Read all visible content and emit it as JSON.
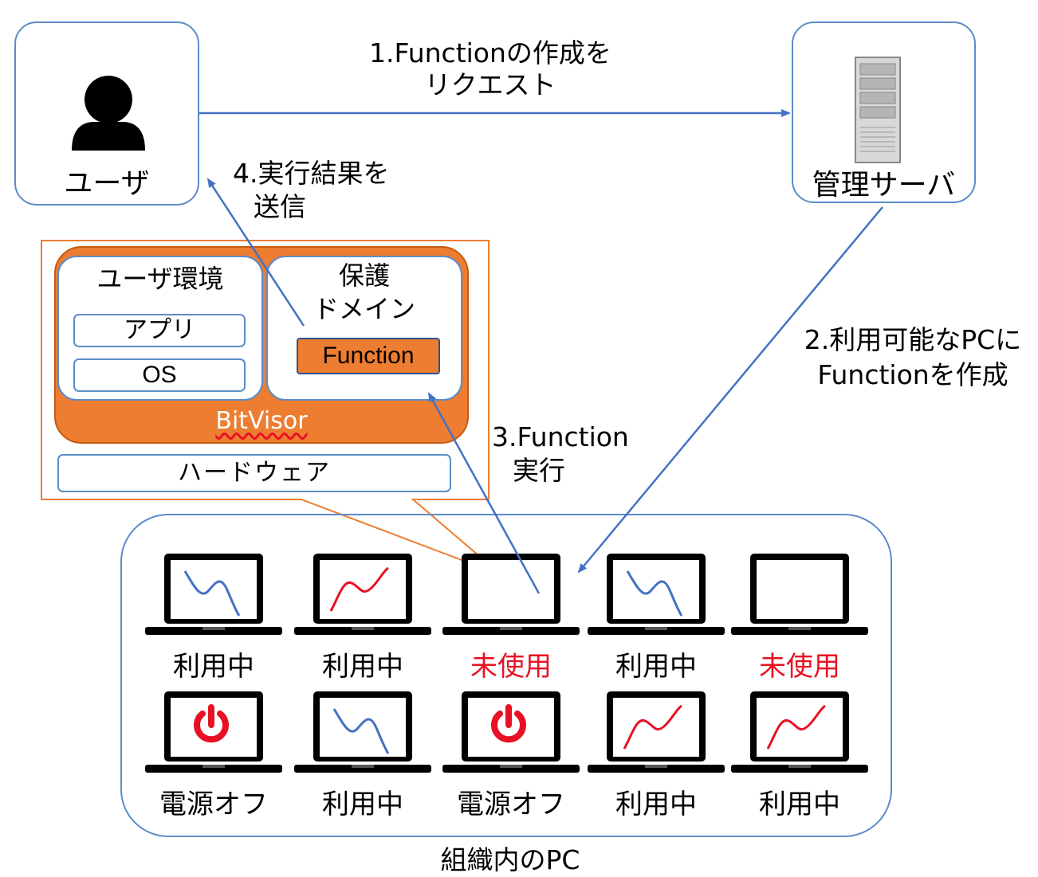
{
  "nodes": {
    "user": {
      "label": "ユーザ"
    },
    "server": {
      "label": "管理サーバ"
    }
  },
  "steps": {
    "step1": {
      "line1": "1.Functionの作成を",
      "line2": "リクエスト"
    },
    "step2": {
      "line1": "2.利用可能なPCに",
      "line2": "Functionを作成"
    },
    "step3": {
      "line1": "3.Function",
      "line2": "実行"
    },
    "step4": {
      "line1": "4.実行結果を",
      "line2": "送信"
    }
  },
  "stack": {
    "user_env": {
      "title": "ユーザ環境",
      "app": "アプリ",
      "os": "OS"
    },
    "protected": {
      "title1": "保護",
      "title2": "ドメイン",
      "function": "Function"
    },
    "hypervisor": "BitVisor",
    "hardware": "ハードウェア"
  },
  "pcs": {
    "group_label": "組織内のPC",
    "row1": [
      {
        "status": "利用中",
        "screen": "wave-down",
        "color": "#4472c4"
      },
      {
        "status": "利用中",
        "screen": "wave-up",
        "color": "#e81123"
      },
      {
        "status": "未使用",
        "screen": "empty",
        "color": "#e81123"
      },
      {
        "status": "利用中",
        "screen": "wave-down",
        "color": "#4472c4"
      },
      {
        "status": "未使用",
        "screen": "empty",
        "color": "#e81123"
      }
    ],
    "row2": [
      {
        "status": "電源オフ",
        "screen": "power-icon",
        "color": "#e81123"
      },
      {
        "status": "利用中",
        "screen": "wave-down",
        "color": "#4472c4"
      },
      {
        "status": "電源オフ",
        "screen": "power-icon",
        "color": "#e81123"
      },
      {
        "status": "利用中",
        "screen": "wave-up",
        "color": "#e81123"
      },
      {
        "status": "利用中",
        "screen": "wave-up",
        "color": "#e81123"
      }
    ]
  },
  "colors": {
    "box_border": "#5b8cc8",
    "arrow": "#4472c4",
    "hypervisor_fill": "#ed7d31",
    "callout": "#ed7d31",
    "unused_text": "#e81123"
  }
}
